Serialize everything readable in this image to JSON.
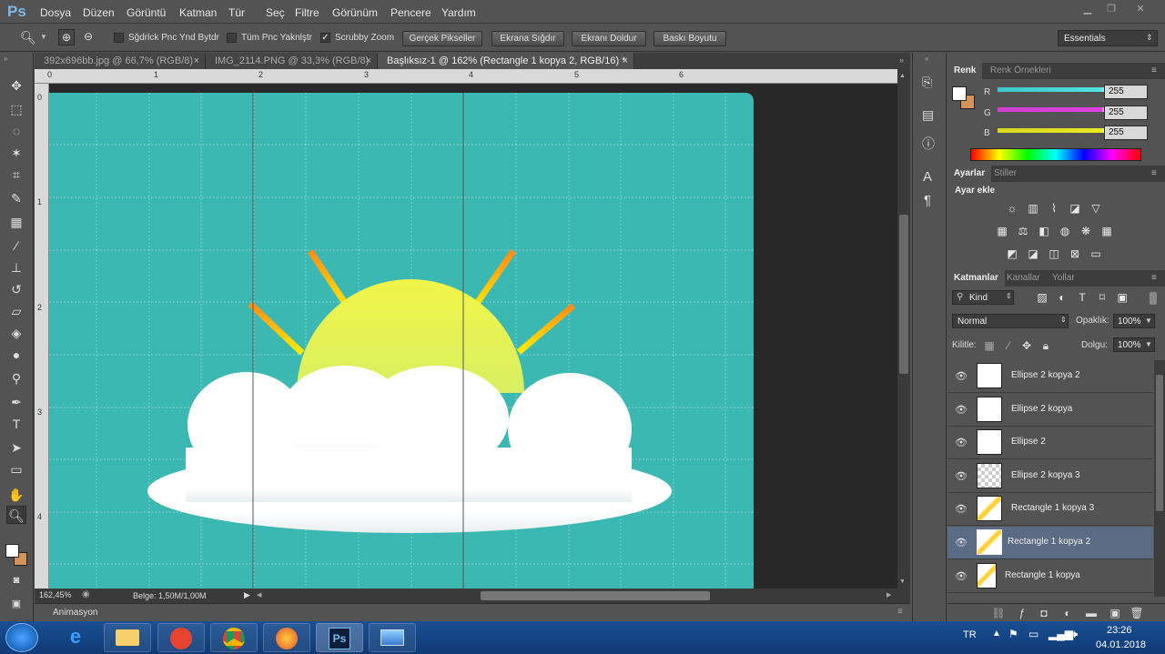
{
  "app": {
    "logo": "Ps"
  },
  "menu": [
    "Dosya",
    "Düzen",
    "Görüntü",
    "Katman",
    "Tür",
    "Seç",
    "Filtre",
    "Görünüm",
    "Pencere",
    "Yardım"
  ],
  "options": {
    "resize_windows": "Sğdrlck Pnc Ynd Bytdr",
    "all_windows": "Tüm Pnc Yaknlştr",
    "scrubby": "Scrubby Zoom",
    "actual_pixels": "Gerçek Pikseller",
    "fit_screen": "Ekrana Sığdır",
    "fill_screen": "Ekranı Doldur",
    "print_size": "Baskı Boyutu",
    "workspace": "Essentials",
    "scrubby_checked": true
  },
  "tabs": [
    {
      "label": "392x696bb.jpg @ 66,7% (RGB/8)",
      "active": false
    },
    {
      "label": "IMG_2114.PNG @ 33,3% (RGB/8)",
      "active": false
    },
    {
      "label": "Başlıksız-1 @ 162% (Rectangle 1 kopya 2, RGB/16) *",
      "active": true
    }
  ],
  "close_glyph": "×",
  "hruler_ticks": [
    "0",
    "1",
    "2",
    "3",
    "4",
    "5",
    "6"
  ],
  "vruler_ticks": [
    "0",
    "1",
    "2",
    "3",
    "4"
  ],
  "status": {
    "zoom": "162,45%",
    "doc": "Belge: 1,50M/1,00M"
  },
  "animation_label": "Animasyon",
  "color_panel": {
    "tabs": [
      "Renk",
      "Renk Örnekleri"
    ],
    "channels": [
      {
        "label": "R",
        "value": "255",
        "color": "#4fe0e0"
      },
      {
        "label": "G",
        "value": "255",
        "color": "#e040e0"
      },
      {
        "label": "B",
        "value": "255",
        "color": "#e8e820"
      }
    ]
  },
  "adjust_panel": {
    "tabs": [
      "Ayarlar",
      "Stiller"
    ],
    "title": "Ayar ekle"
  },
  "layers_panel": {
    "tabs": [
      "Katmanlar",
      "Kanallar",
      "Yollar"
    ],
    "kind": "Kind",
    "blend_mode": "Normal",
    "opacity_label": "Opaklık:",
    "opacity": "100%",
    "lock_label": "Kilitle:",
    "fill_label": "Dolgu:",
    "fill": "100%",
    "layers": [
      {
        "name": "Ellipse 2 kopya 2",
        "selected": false,
        "thumb": "white"
      },
      {
        "name": "Ellipse 2 kopya",
        "selected": false,
        "thumb": "white"
      },
      {
        "name": "Ellipse 2",
        "selected": false,
        "thumb": "white"
      },
      {
        "name": "Ellipse 2 kopya 3",
        "selected": false,
        "thumb": "checker"
      },
      {
        "name": "Rectangle 1 kopya 3",
        "selected": false,
        "thumb": "ray"
      },
      {
        "name": "Rectangle 1 kopya 2",
        "selected": true,
        "thumb": "ray"
      },
      {
        "name": "Rectangle 1 kopya",
        "selected": false,
        "thumb": "ray"
      }
    ]
  },
  "taskbar": {
    "lang": "TR",
    "time": "23:26",
    "date": "04.01.2018"
  },
  "colors": {
    "canvas_bg": "#3cb8b2",
    "sun": "#e8f25a",
    "cloud": "#ffffff",
    "ray_start": "#ff8c1a",
    "ray_end": "#ffee00",
    "accent": "#5b6b83"
  }
}
